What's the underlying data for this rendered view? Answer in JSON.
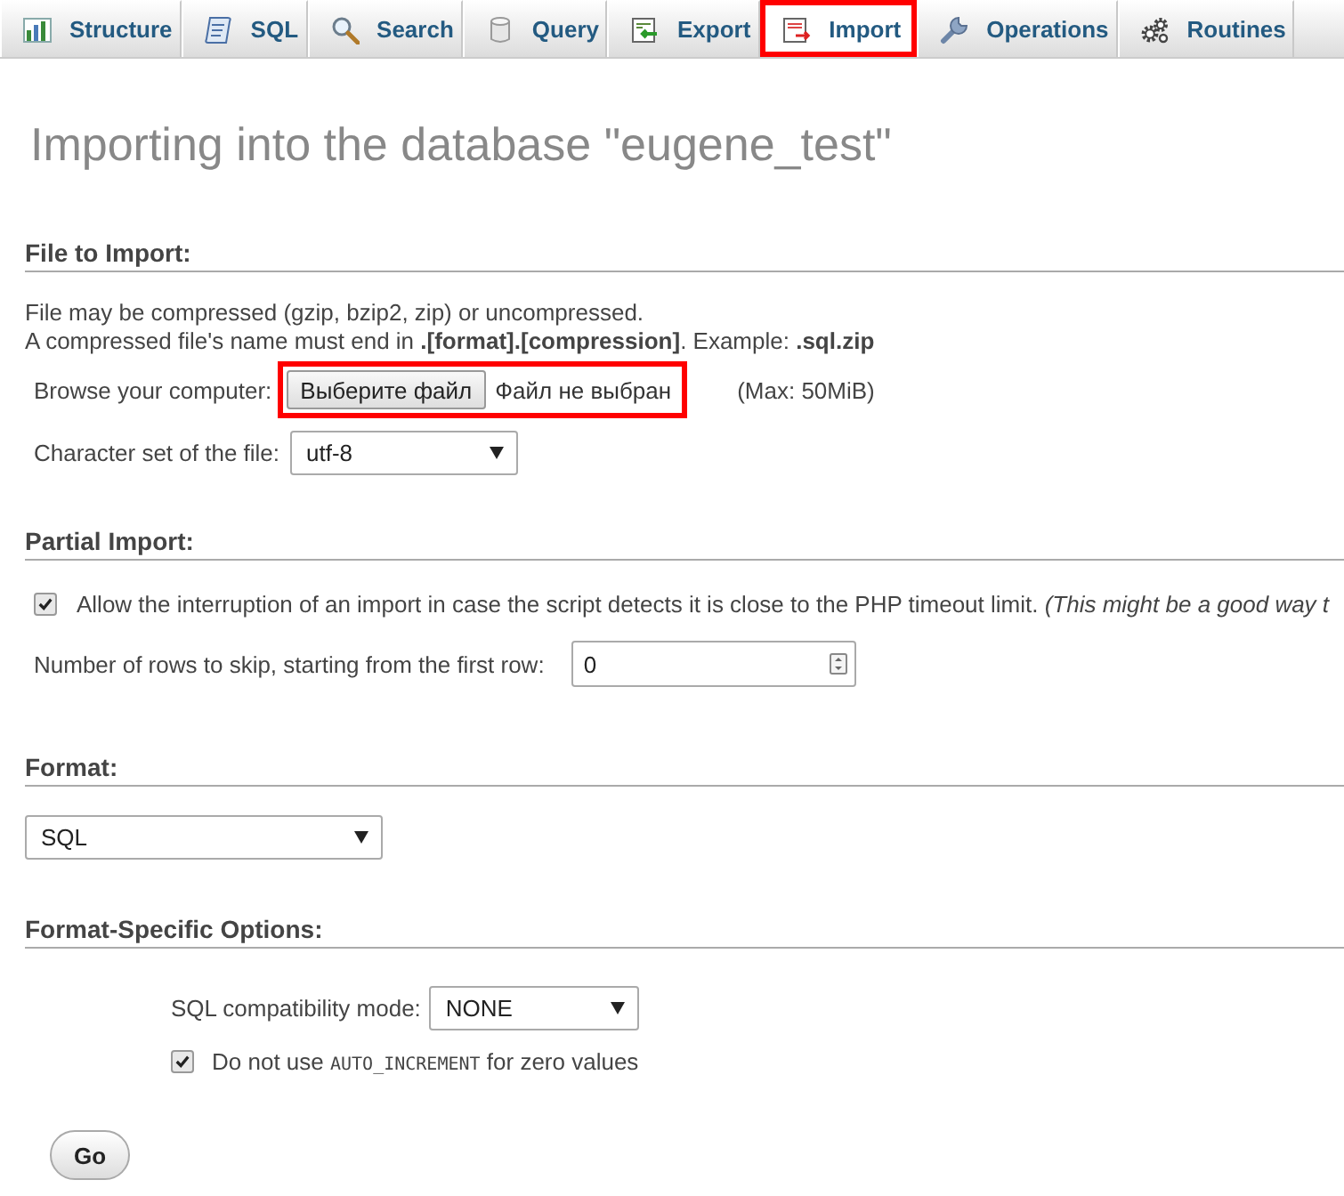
{
  "tabs": [
    {
      "label": "Structure",
      "selected": false,
      "highlighted": false
    },
    {
      "label": "SQL",
      "selected": false,
      "highlighted": false
    },
    {
      "label": "Search",
      "selected": false,
      "highlighted": false
    },
    {
      "label": "Query",
      "selected": false,
      "highlighted": false
    },
    {
      "label": "Export",
      "selected": false,
      "highlighted": false
    },
    {
      "label": "Import",
      "selected": true,
      "highlighted": true
    },
    {
      "label": "Operations",
      "selected": false,
      "highlighted": false
    },
    {
      "label": "Routines",
      "selected": false,
      "highlighted": false
    }
  ],
  "title": "Importing into the database \"eugene_test\"",
  "file_to_import": {
    "heading": "File to Import:",
    "notes": [
      "File may be compressed (gzip, bzip2, zip) or uncompressed.",
      "A compressed file's name must end in **.[format].[compression]**. Example: **.sql.zip**"
    ],
    "browse": {
      "label": "Browse your computer:",
      "button": "Выберите файл",
      "status": "Файл не выбран",
      "highlighted": true,
      "max": "(Max: 50MiB)"
    },
    "charset": {
      "label": "Character set of the file:",
      "value": "utf-8"
    }
  },
  "partial_import": {
    "heading": "Partial Import:",
    "allow_interrupt": {
      "checked": true,
      "text": "Allow the interruption of an import in case the script detects it is close to the PHP timeout limit. *(This might be a good way t*"
    },
    "skip_rows": {
      "label": "Number of rows to skip, starting from the first row:",
      "value": "0"
    }
  },
  "format": {
    "heading": "Format:",
    "value": "SQL"
  },
  "format_options": {
    "heading": "Format-Specific Options:",
    "compat": {
      "label": "SQL compatibility mode:",
      "value": "NONE"
    },
    "no_auto_increment": {
      "checked": true,
      "text_before": "Do not use",
      "code": "AUTO_INCREMENT",
      "text_after": "for zero values"
    }
  },
  "go_button": "Go"
}
